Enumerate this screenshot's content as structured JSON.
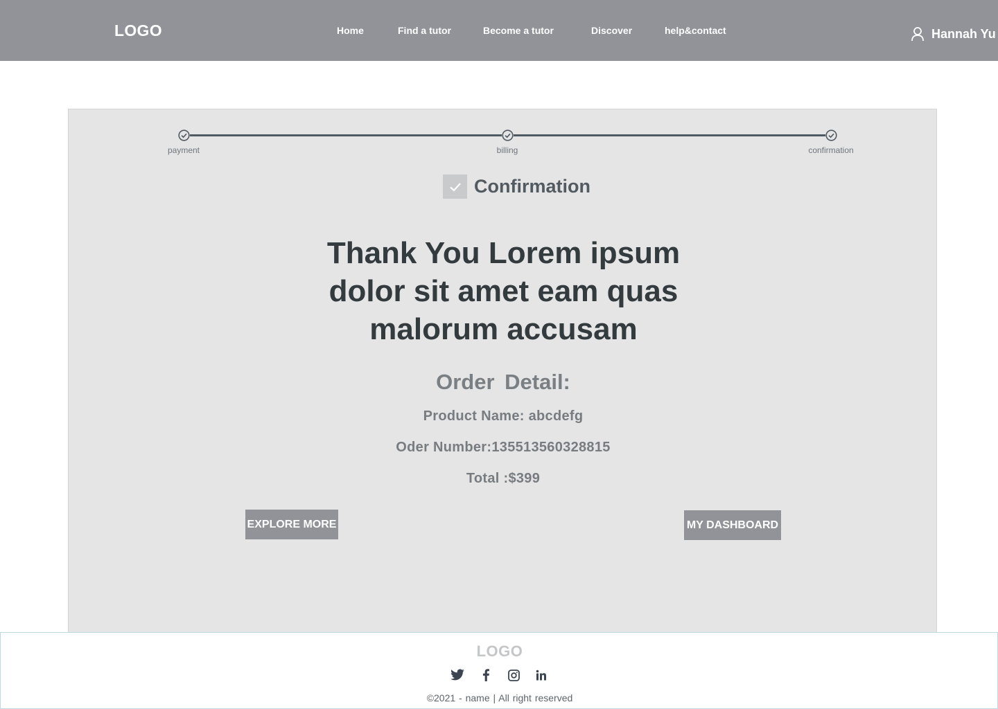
{
  "header": {
    "logo": "LOGO",
    "nav": [
      "Home",
      "Find a tutor",
      "Become a tutor",
      "Discover",
      "help&contact"
    ],
    "user_name": "Hannah Yu"
  },
  "progress": {
    "steps": [
      "payment",
      "billing",
      "confirmation"
    ]
  },
  "confirmation": {
    "title": "Confirmation",
    "message": "Thank You Lorem ipsum dolor sit amet eam quas malorum accusam"
  },
  "order": {
    "heading": "Order  Detail:",
    "product": "Product Name: abcdefg",
    "number": "Oder Number:135513560328815",
    "total": "Total :$399"
  },
  "buttons": {
    "explore": "EXPLORE MORE",
    "dashboard": "MY DASHBOARD"
  },
  "footer": {
    "logo": "LOGO",
    "social": [
      "twitter-icon",
      "facebook-icon",
      "instagram-icon",
      "linkedin-icon"
    ],
    "copyright": "©2021 - name |   All right reserved"
  },
  "colors": {
    "header_bg": "#929398",
    "card_bg": "#e5e5e6",
    "button_bg": "#929398",
    "text_dark": "#333b3f"
  }
}
